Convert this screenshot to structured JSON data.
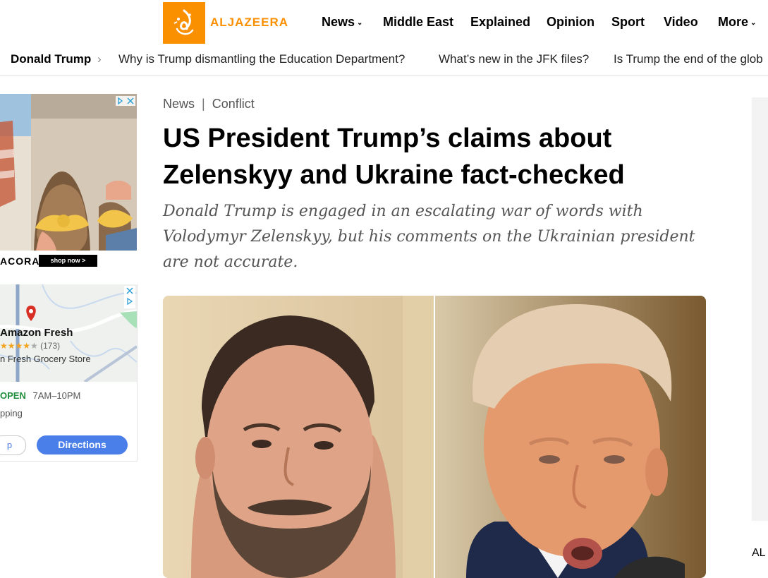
{
  "logo": {
    "text": "ALJAZEERA"
  },
  "nav": {
    "items": [
      {
        "label": "News",
        "dropdown": true
      },
      {
        "label": "Middle East",
        "dropdown": false
      },
      {
        "label": "Explained",
        "dropdown": false
      },
      {
        "label": "Opinion",
        "dropdown": false
      },
      {
        "label": "Sport",
        "dropdown": false
      },
      {
        "label": "Video",
        "dropdown": false
      },
      {
        "label": "More",
        "dropdown": true
      }
    ]
  },
  "subnav": {
    "main": "Donald Trump",
    "links": [
      "Why is Trump dismantling the Education Department?",
      "What’s new in the JFK files?",
      "Is Trump the end of the glob"
    ]
  },
  "ad_fashion": {
    "brand": "ACORA",
    "cta": "shop now >"
  },
  "ad_map": {
    "name": "Amazon Fresh",
    "review_count": "(173)",
    "subtitle": "n Fresh Grocery Store",
    "status": "OPEN",
    "hours": "7AM–10PM",
    "category": "pping",
    "button_secondary": "p",
    "button_primary": "Directions",
    "rating": 3.5
  },
  "article": {
    "breadcrumb_1": "News",
    "breadcrumb_sep": "|",
    "breadcrumb_2": "Conflict",
    "title": "US President Trump’s claims about Zelenskyy and Ukraine fact-checked",
    "standfirst": "Donald Trump is engaged in an escalating war of words with Volodymyr Zelenskyy, but his comments on the Ukrainian president are not accurate."
  },
  "right_rail": {
    "label": "AL"
  },
  "colors": {
    "brand": "#fa9000",
    "map_button": "#4a7ee8",
    "open_green": "#1e8e3e"
  }
}
